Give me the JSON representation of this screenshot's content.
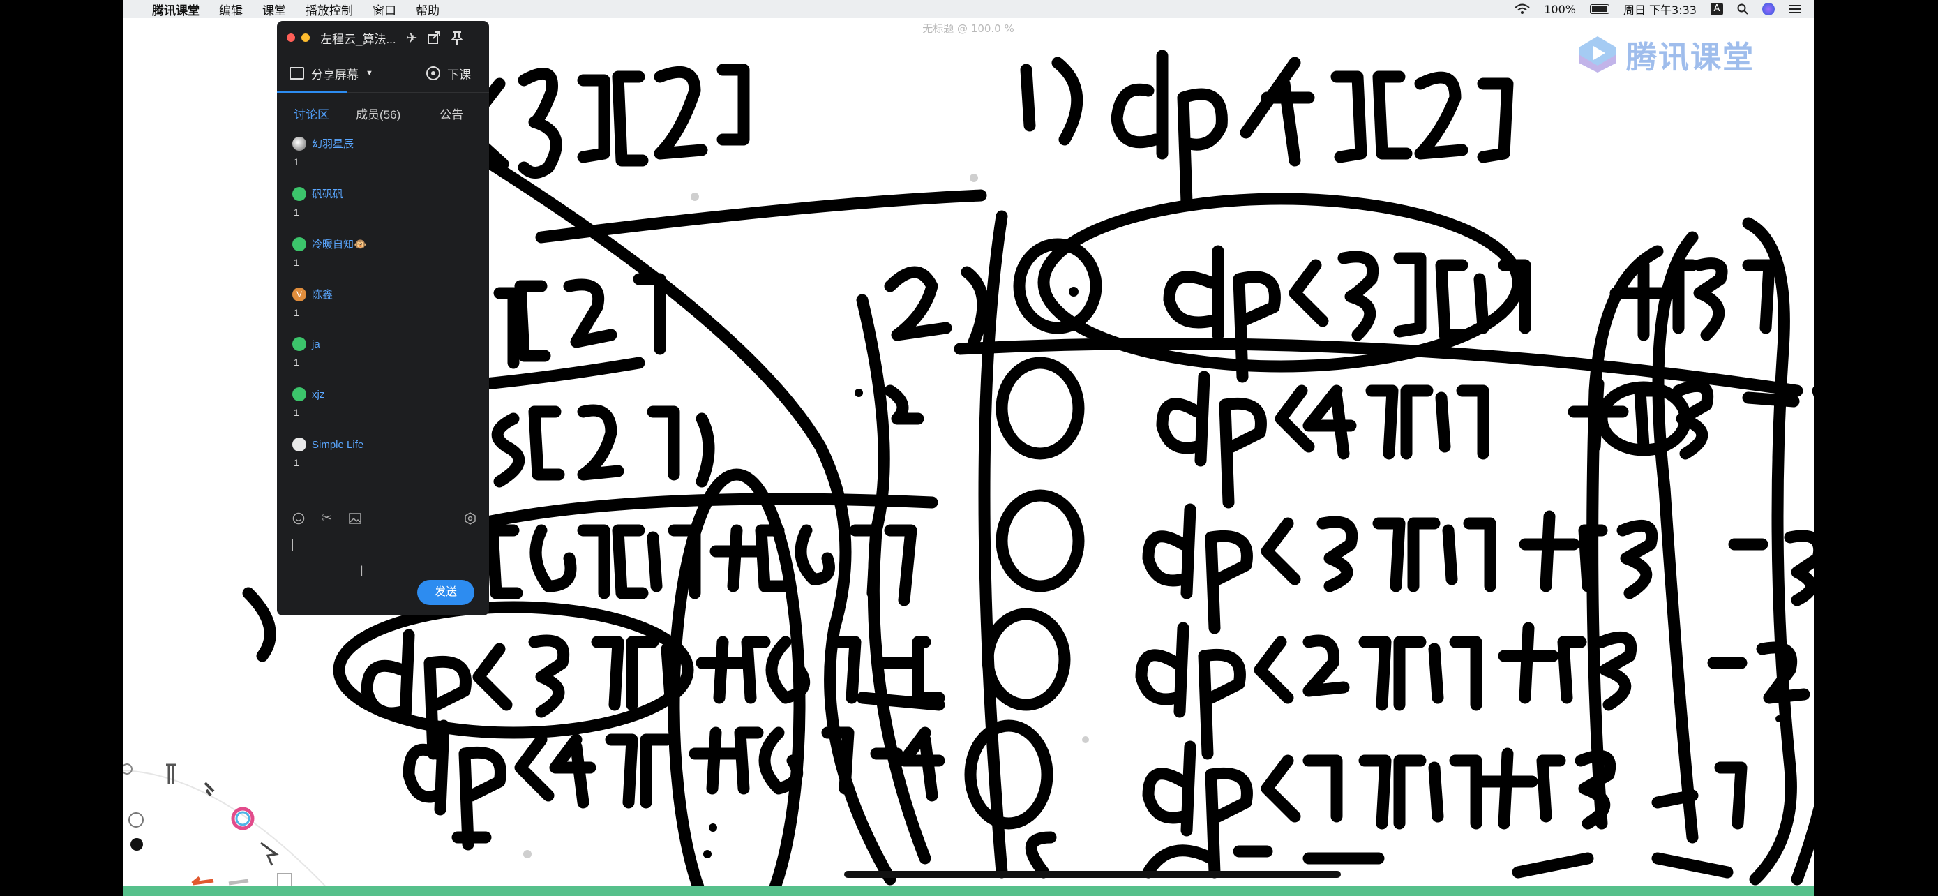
{
  "menubar": {
    "app_name": "腾讯课堂",
    "menus": [
      "编辑",
      "课堂",
      "播放控制",
      "窗口",
      "帮助"
    ],
    "battery": "100%",
    "clock": "周日 下午3:33"
  },
  "whiteboard": {
    "title": "无标题 @ 100.0 %",
    "brand": "腾讯课堂"
  },
  "panel": {
    "title": "左程云_算法...",
    "share_label": "分享屏幕",
    "end_label": "下课",
    "tabs": [
      "讨论区",
      "成员(56)",
      "公告"
    ],
    "messages": [
      {
        "user": "幻羽星辰",
        "text": "1",
        "avatar": "photo"
      },
      {
        "user": "矾矾矾",
        "text": "1",
        "avatar": "wechat"
      },
      {
        "user": "冷暖自知🐵",
        "text": "1",
        "avatar": "wechat"
      },
      {
        "user": "陈鑫",
        "text": "1",
        "avatar": "V"
      },
      {
        "user": "ja",
        "text": "1",
        "avatar": "wechat"
      },
      {
        "user": "xjz",
        "text": "1",
        "avatar": "wechat"
      },
      {
        "user": "Simple Life",
        "text": "1",
        "avatar": "sl"
      }
    ],
    "send_label": "发送",
    "input_tools": [
      "emoji-icon",
      "scissors-icon",
      "image-icon",
      "settings-icon"
    ]
  }
}
